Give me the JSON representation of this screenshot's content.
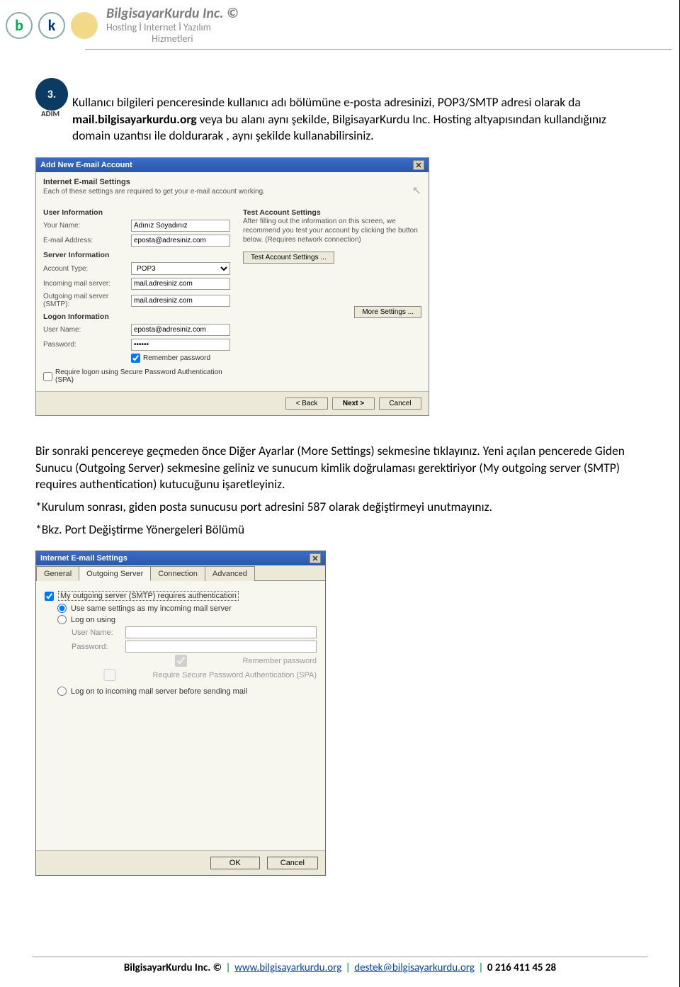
{
  "header": {
    "company": "BilgisayarKurdu Inc. ©",
    "tagline1": "Hosting İ Internet İ Yazılım",
    "tagline2": "Hizmetleri"
  },
  "step": {
    "num": "3.",
    "label": "ADIM"
  },
  "para1": "Kullanıcı bilgileri penceresinde kullanıcı adı bölümüne e-posta adresinizi, POP3/SMTP adresi olarak da mail.bilgisayarkurdu.org veya bu alanı aynı şekilde, BilgisayarKurdu Inc. Hosting altyapısından kullandığınız domain uzantısı ile doldurarak ,  aynı şekilde kullanabilirsiniz.",
  "para1_bold": "mail.bilgisayarkurdu.org",
  "para2": "Bir sonraki pencereye geçmeden önce Diğer Ayarlar (More Settings) sekmesine tıklayınız. Yeni açılan pencerede Giden Sunucu (Outgoing Server) sekmesine geliniz ve sunucum kimlik doğrulaması gerektiriyor (My outgoing server (SMTP) requires authentication) kutucuğunu işaretleyiniz.",
  "para3": "*Kurulum sonrası, giden posta sunucusu port adresini 587 olarak değiştirmeyi unutmayınız.",
  "para4": "*Bkz. Port Değiştirme Yönergeleri Bölümü",
  "dialog1": {
    "title": "Add New E-mail Account",
    "heading": "Internet E-mail Settings",
    "desc": "Each of these settings are required to get your e-mail account working.",
    "user_info": "User Information",
    "your_name_lbl": "Your Name:",
    "your_name_val": "Adınız Soyadınız",
    "email_lbl": "E-mail Address:",
    "email_val": "eposta@adresiniz.com",
    "server_info": "Server Information",
    "acct_type_lbl": "Account Type:",
    "acct_type_val": "POP3",
    "incoming_lbl": "Incoming mail server:",
    "incoming_val": "mail.adresiniz.com",
    "outgoing_lbl": "Outgoing mail server (SMTP):",
    "outgoing_val": "mail.adresiniz.com",
    "logon_info": "Logon Information",
    "user_lbl": "User Name:",
    "user_val": "eposta@adresiniz.com",
    "pass_lbl": "Password:",
    "pass_val": "******",
    "remember": "Remember password",
    "spa": "Require logon using Secure Password Authentication (SPA)",
    "test_heading": "Test Account Settings",
    "test_desc": "After filling out the information on this screen, we recommend you test your account by clicking the button below. (Requires network connection)",
    "test_btn": "Test Account Settings ...",
    "more_btn": "More Settings ...",
    "back": "< Back",
    "next": "Next >",
    "cancel": "Cancel"
  },
  "dialog2": {
    "title": "Internet E-mail Settings",
    "tabs": {
      "general": "General",
      "outgoing": "Outgoing Server",
      "connection": "Connection",
      "advanced": "Advanced"
    },
    "chk_main": "My outgoing server (SMTP) requires authentication",
    "radio_same": "Use same settings as my incoming mail server",
    "radio_logon": "Log on using",
    "user_lbl": "User Name:",
    "pass_lbl": "Password:",
    "remember": "Remember password",
    "spa": "Require Secure Password Authentication (SPA)",
    "radio_before": "Log on to incoming mail server before sending mail",
    "ok": "OK",
    "cancel": "Cancel"
  },
  "footer": {
    "company": "BilgisayarKurdu Inc. ©",
    "url": "www.bilgisayarkurdu.org",
    "email": "destek@bilgisayarkurdu.org",
    "phone": "0 216 411 45 28"
  }
}
